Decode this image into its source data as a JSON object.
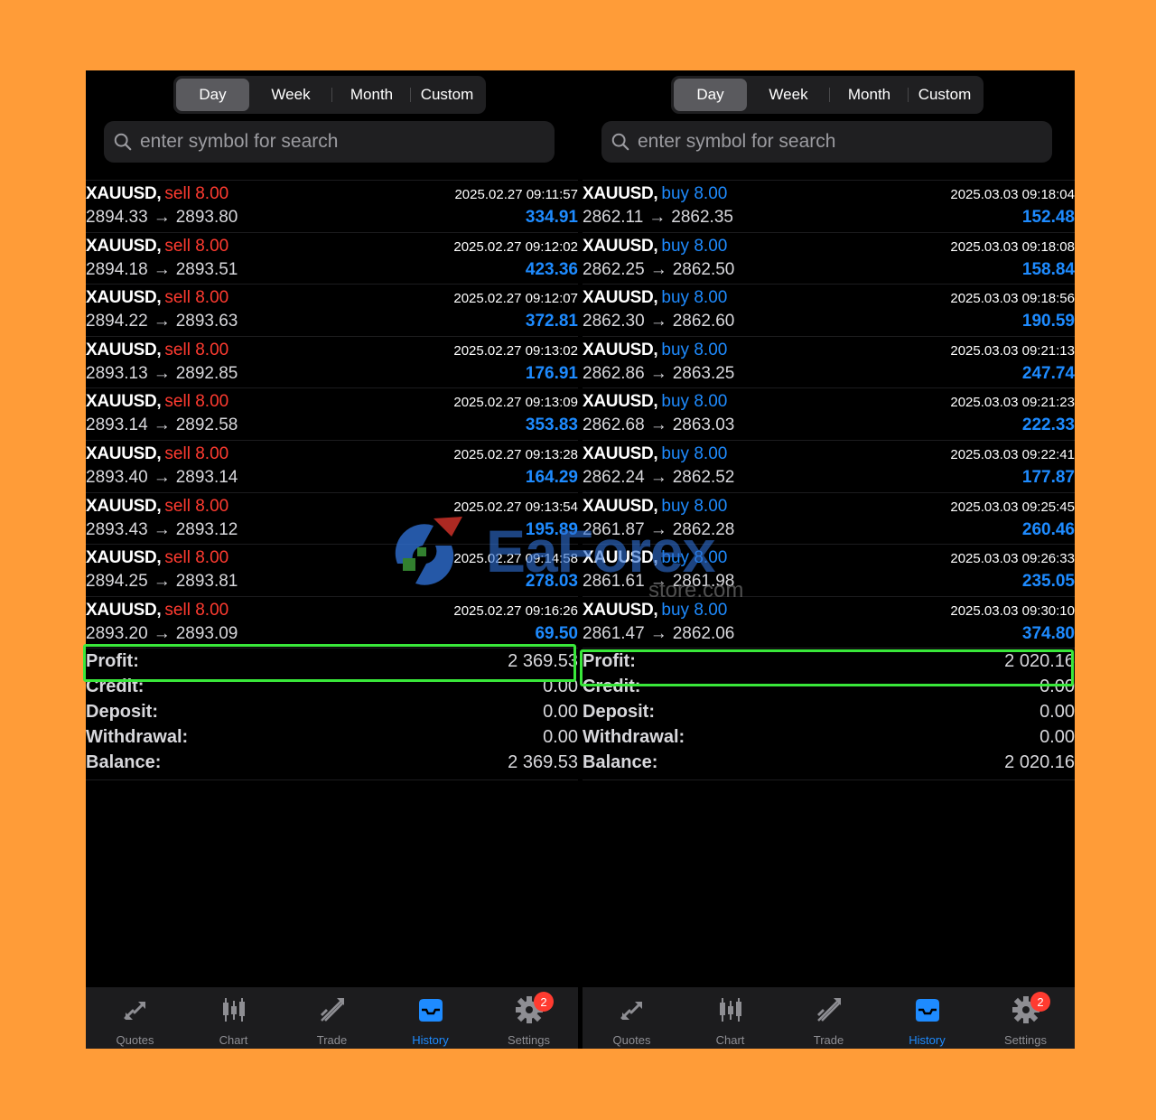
{
  "segments": [
    "Day",
    "Week",
    "Month",
    "Custom"
  ],
  "active_segment": "Day",
  "search": {
    "placeholder": "enter symbol for search"
  },
  "panels": [
    {
      "trades": [
        {
          "symbol": "XAUUSD,",
          "side": "sell",
          "volume": "8.00",
          "time": "2025.02.27 09:11:57",
          "open": "2894.33",
          "close": "2893.80",
          "profit": "334.91"
        },
        {
          "symbol": "XAUUSD,",
          "side": "sell",
          "volume": "8.00",
          "time": "2025.02.27 09:12:02",
          "open": "2894.18",
          "close": "2893.51",
          "profit": "423.36"
        },
        {
          "symbol": "XAUUSD,",
          "side": "sell",
          "volume": "8.00",
          "time": "2025.02.27 09:12:07",
          "open": "2894.22",
          "close": "2893.63",
          "profit": "372.81"
        },
        {
          "symbol": "XAUUSD,",
          "side": "sell",
          "volume": "8.00",
          "time": "2025.02.27 09:13:02",
          "open": "2893.13",
          "close": "2892.85",
          "profit": "176.91"
        },
        {
          "symbol": "XAUUSD,",
          "side": "sell",
          "volume": "8.00",
          "time": "2025.02.27 09:13:09",
          "open": "2893.14",
          "close": "2892.58",
          "profit": "353.83"
        },
        {
          "symbol": "XAUUSD,",
          "side": "sell",
          "volume": "8.00",
          "time": "2025.02.27 09:13:28",
          "open": "2893.40",
          "close": "2893.14",
          "profit": "164.29"
        },
        {
          "symbol": "XAUUSD,",
          "side": "sell",
          "volume": "8.00",
          "time": "2025.02.27 09:13:54",
          "open": "2893.43",
          "close": "2893.12",
          "profit": "195.89"
        },
        {
          "symbol": "XAUUSD,",
          "side": "sell",
          "volume": "8.00",
          "time": "2025.02.27 09:14:58",
          "open": "2894.25",
          "close": "2893.81",
          "profit": "278.03"
        },
        {
          "symbol": "XAUUSD,",
          "side": "sell",
          "volume": "8.00",
          "time": "2025.02.27 09:16:26",
          "open": "2893.20",
          "close": "2893.09",
          "profit": "69.50"
        }
      ],
      "summary": [
        {
          "label": "Profit:",
          "value": "2 369.53"
        },
        {
          "label": "Credit:",
          "value": "0.00"
        },
        {
          "label": "Deposit:",
          "value": "0.00"
        },
        {
          "label": "Withdrawal:",
          "value": "0.00"
        },
        {
          "label": "Balance:",
          "value": "2 369.53"
        }
      ]
    },
    {
      "trades": [
        {
          "symbol": "XAUUSD,",
          "side": "buy",
          "volume": "8.00",
          "time": "2025.03.03 09:18:04",
          "open": "2862.11",
          "close": "2862.35",
          "profit": "152.48"
        },
        {
          "symbol": "XAUUSD,",
          "side": "buy",
          "volume": "8.00",
          "time": "2025.03.03 09:18:08",
          "open": "2862.25",
          "close": "2862.50",
          "profit": "158.84"
        },
        {
          "symbol": "XAUUSD,",
          "side": "buy",
          "volume": "8.00",
          "time": "2025.03.03 09:18:56",
          "open": "2862.30",
          "close": "2862.60",
          "profit": "190.59"
        },
        {
          "symbol": "XAUUSD,",
          "side": "buy",
          "volume": "8.00",
          "time": "2025.03.03 09:21:13",
          "open": "2862.86",
          "close": "2863.25",
          "profit": "247.74"
        },
        {
          "symbol": "XAUUSD,",
          "side": "buy",
          "volume": "8.00",
          "time": "2025.03.03 09:21:23",
          "open": "2862.68",
          "close": "2863.03",
          "profit": "222.33"
        },
        {
          "symbol": "XAUUSD,",
          "side": "buy",
          "volume": "8.00",
          "time": "2025.03.03 09:22:41",
          "open": "2862.24",
          "close": "2862.52",
          "profit": "177.87"
        },
        {
          "symbol": "XAUUSD,",
          "side": "buy",
          "volume": "8.00",
          "time": "2025.03.03 09:25:45",
          "open": "2861.87",
          "close": "2862.28",
          "profit": "260.46"
        },
        {
          "symbol": "XAUUSD,",
          "side": "buy",
          "volume": "8.00",
          "time": "2025.03.03 09:26:33",
          "open": "2861.61",
          "close": "2861.98",
          "profit": "235.05"
        },
        {
          "symbol": "XAUUSD,",
          "side": "buy",
          "volume": "8.00",
          "time": "2025.03.03 09:30:10",
          "open": "2861.47",
          "close": "2862.06",
          "profit": "374.80"
        }
      ],
      "summary": [
        {
          "label": "Profit:",
          "value": "2 020.16"
        },
        {
          "label": "Credit:",
          "value": "0.00"
        },
        {
          "label": "Deposit:",
          "value": "0.00"
        },
        {
          "label": "Withdrawal:",
          "value": "0.00"
        },
        {
          "label": "Balance:",
          "value": "2 020.16"
        }
      ]
    }
  ],
  "tabs": [
    {
      "label": "Quotes",
      "icon": "quotes-icon"
    },
    {
      "label": "Chart",
      "icon": "candlestick-icon"
    },
    {
      "label": "Trade",
      "icon": "trade-icon"
    },
    {
      "label": "History",
      "icon": "inbox-icon",
      "active": true
    },
    {
      "label": "Settings",
      "icon": "gear-icon",
      "badge": "2"
    }
  ],
  "watermark": {
    "brand": "EaForex",
    "sub": "store.com"
  },
  "colors": {
    "sell": "#ff3b30",
    "buy": "#1e8bff",
    "highlight": "#39e83a",
    "background": "#FF9C38"
  }
}
